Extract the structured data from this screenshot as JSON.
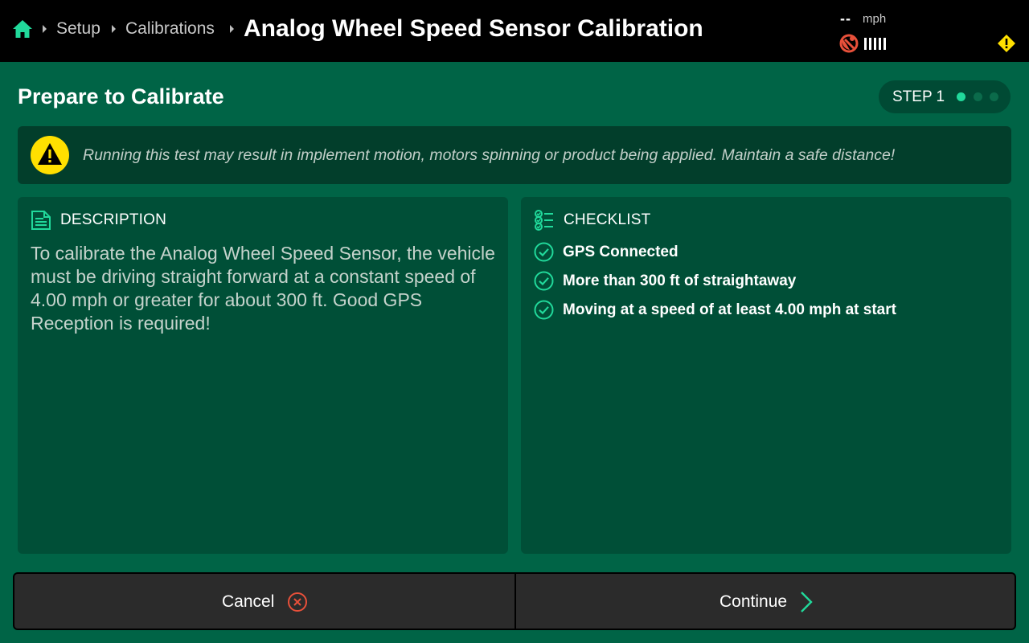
{
  "header": {
    "breadcrumb": [
      "Setup",
      "Calibrations"
    ],
    "title": "Analog Wheel Speed Sensor Calibration",
    "speed_value": "--",
    "speed_unit": "mph"
  },
  "step": {
    "title": "Prepare to Calibrate",
    "label": "STEP 1",
    "current": 1,
    "total": 3
  },
  "warning": {
    "text": "Running this test may result in implement motion, motors spinning or product being applied. Maintain a safe distance!"
  },
  "description": {
    "heading": "DESCRIPTION",
    "text": "To calibrate the Analog Wheel Speed Sensor, the vehicle must be driving straight forward at a constant speed of 4.00 mph or greater for about 300 ft. Good GPS Reception is required!"
  },
  "checklist": {
    "heading": "CHECKLIST",
    "items": [
      {
        "label": "GPS Connected",
        "checked": true
      },
      {
        "label": "More than 300 ft of straightaway",
        "checked": true
      },
      {
        "label": "Moving at a speed of at least 4.00 mph at start",
        "checked": true
      }
    ]
  },
  "buttons": {
    "cancel": "Cancel",
    "continue": "Continue"
  },
  "colors": {
    "background": "#006446",
    "panel": "#004f37",
    "accent": "#21d99b",
    "warning_yellow": "#ffe000",
    "error_red": "#e8503a"
  },
  "icons": {
    "home": "home-icon",
    "gps_status": "gps-error-icon",
    "signal": "signal-bars-icon",
    "status_warning": "warning-diamond-icon",
    "banner_warning": "warning-triangle-icon",
    "description": "document-icon",
    "checklist": "checklist-icon",
    "check": "check-circle-icon",
    "cancel": "close-circle-icon",
    "continue": "chevron-right-icon"
  }
}
